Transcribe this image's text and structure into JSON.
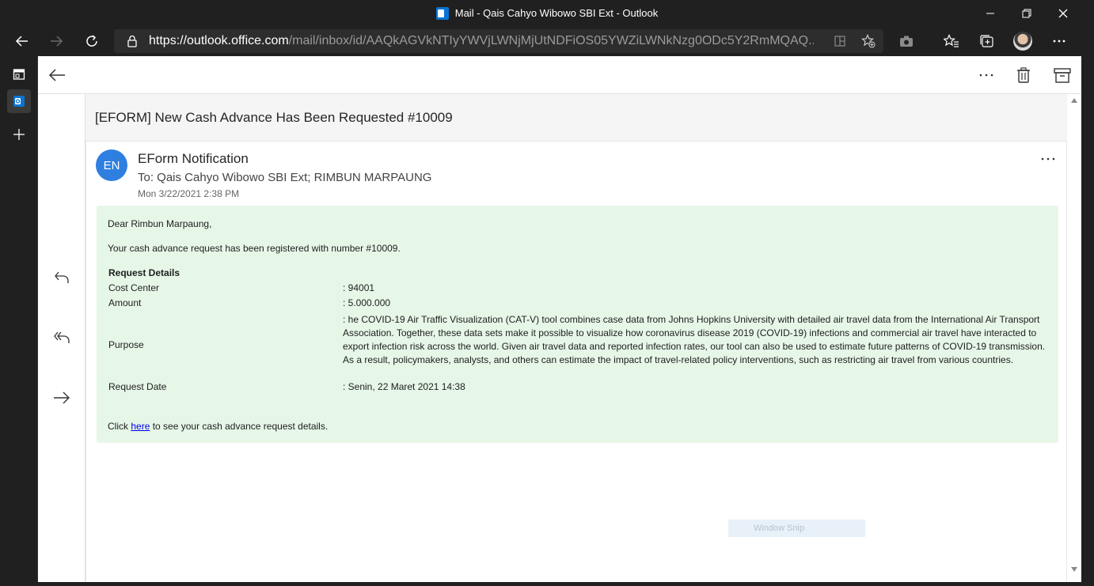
{
  "window": {
    "title": "Mail - Qais Cahyo Wibowo SBI Ext - Outlook"
  },
  "browser": {
    "url_host": "https://outlook.office.com",
    "url_path": "/mail/inbox/id/AAQkAGVkNTIyYWVjLWNjMjUtNDFiOS05YWZiLWNkNzg0ODc5Y2RmMQAQ..."
  },
  "message": {
    "subject": "[EFORM] New Cash Advance Has Been Requested #10009",
    "sender_initials": "EN",
    "sender_name": "EForm Notification",
    "recipients": "To: Qais Cahyo Wibowo SBI Ext;  RIMBUN MARPAUNG",
    "date": "Mon 3/22/2021 2:38 PM",
    "greeting": "Dear Rimbun Marpaung,",
    "intro": "Your cash advance request has been registered with number #10009.",
    "details_heading": "Request Details",
    "details": {
      "cost_center_label": "Cost Center",
      "cost_center_value": ": 94001",
      "amount_label": "Amount",
      "amount_value": ": 5.000.000",
      "purpose_label": "Purpose",
      "purpose_value": ": he COVID-19 Air Traffic Visualization (CAT-V) tool combines case data from Johns Hopkins University with detailed air travel data from the International Air Transport Association. Together, these data sets make it possible to visualize how coronavirus disease 2019 (COVID-19) infections and commercial air travel have interacted to export infection risk across the world. Given air travel data and reported infection rates, our tool can also be used to estimate future patterns of COVID-19 transmission. As a result, policymakers, analysts, and others can estimate the impact of travel-related policy interventions, such as restricting air travel from various countries.",
      "request_date_label": "Request Date",
      "request_date_value": ": Senin, 22 Maret 2021 14:38"
    },
    "footer_pre": "Click ",
    "footer_link": "here",
    "footer_post": " to see your cash advance request details."
  },
  "overlay": {
    "snip_label": "Window Snip"
  }
}
